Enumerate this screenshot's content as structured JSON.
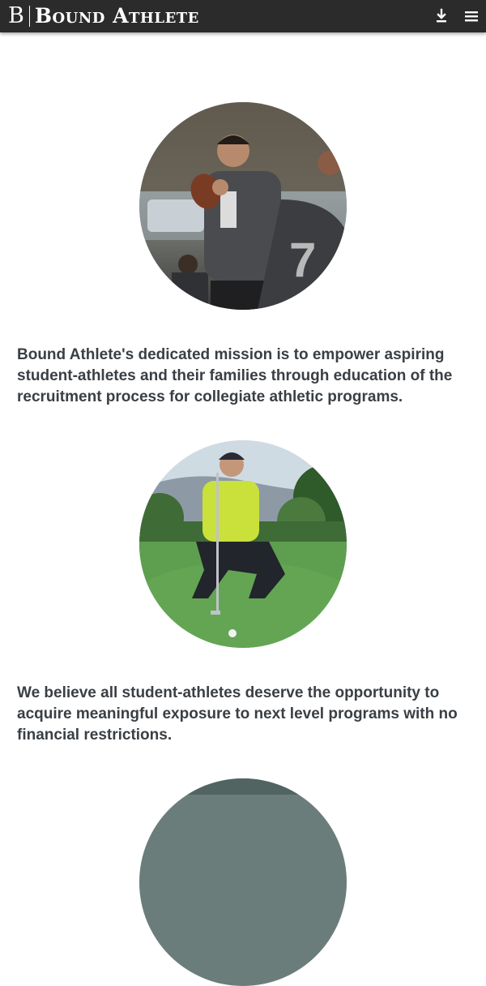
{
  "header": {
    "logo_mark": "B",
    "logo_text": "Bound Athlete",
    "background_color": "#2b2b2b",
    "icons": [
      "download-icon",
      "hamburger-menu-icon"
    ]
  },
  "sections": [
    {
      "image": "football-quarterback-photo",
      "text": "Bound Athlete's dedicated mission is to empower aspiring student-athletes and their families through education of the recruitment process for collegiate athletic programs."
    },
    {
      "image": "golfer-putting-green-photo",
      "text": "We believe all student-athletes deserve the opportunity to acquire meaningful exposure to next level programs with no financial restrictions."
    },
    {
      "image": "third-circular-photo-partial"
    }
  ],
  "colors": {
    "body_text": "#3a3f44",
    "page_background": "#ffffff"
  }
}
